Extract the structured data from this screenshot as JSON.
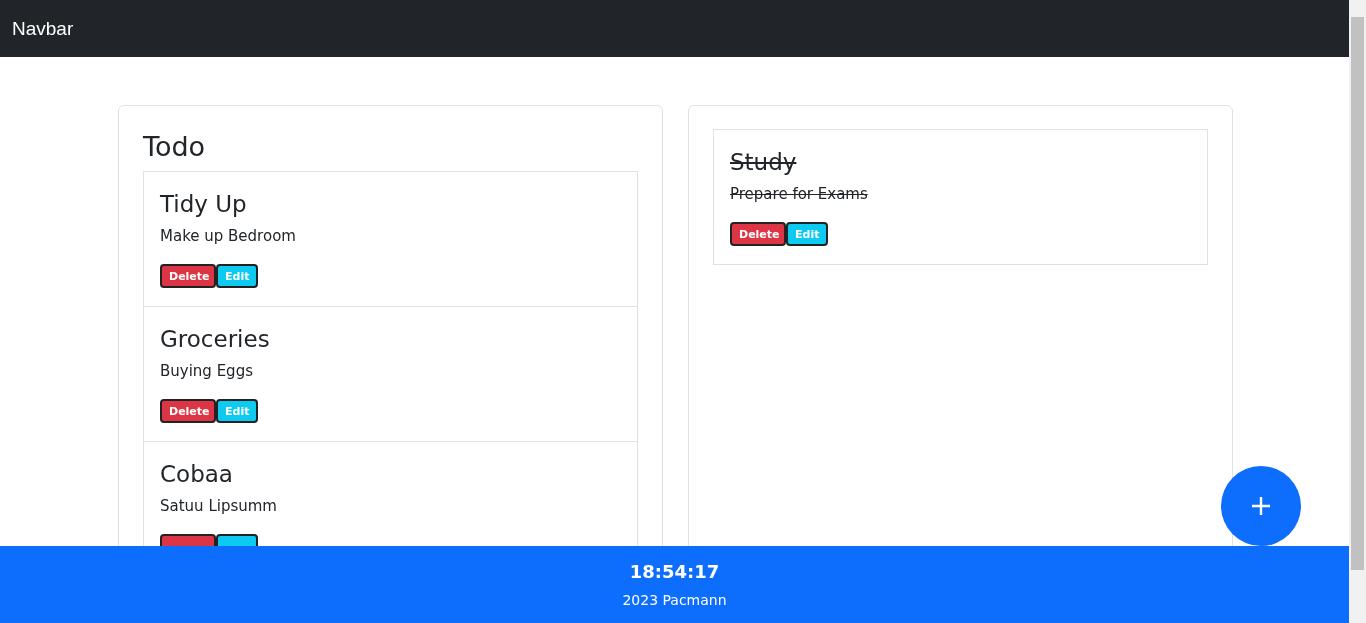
{
  "navbar": {
    "brand": "Navbar"
  },
  "lists": [
    {
      "title": "Todo",
      "items": [
        {
          "title": "Tidy Up",
          "description": "Make up Bedroom",
          "done": false,
          "buttons": [
            {
              "kind": "delete",
              "label": "Delete"
            },
            {
              "kind": "edit",
              "label": "Edit"
            }
          ]
        },
        {
          "title": "Groceries",
          "description": "Buying Eggs",
          "done": false,
          "buttons": [
            {
              "kind": "delete",
              "label": "Delete"
            },
            {
              "kind": "edit",
              "label": "Edit"
            }
          ]
        },
        {
          "title": "Cobaa",
          "description": "Satuu Lipsumm",
          "done": false,
          "buttons": [
            {
              "kind": "delete"
            },
            {
              "kind": "edit"
            }
          ]
        }
      ]
    },
    {
      "items": [
        {
          "title": "Study",
          "description": "Prepare for Exams",
          "done": true,
          "buttons": [
            {
              "kind": "delete",
              "label": "Delete"
            },
            {
              "kind": "edit",
              "label": "Edit"
            }
          ]
        }
      ]
    }
  ],
  "footer": {
    "time": "18:54:17",
    "copyright": "2023 Pacmann"
  }
}
